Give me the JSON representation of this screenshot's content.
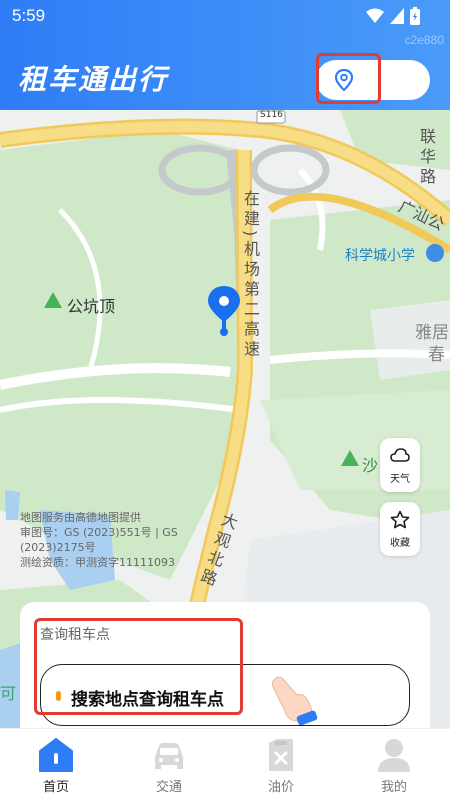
{
  "status_bar": {
    "time": "5:59"
  },
  "device_id": "c2e880",
  "header": {
    "title": "租车通出行"
  },
  "map": {
    "roads": {
      "top_route": "S116",
      "airport_road": "在建)机场第二高速",
      "daguan_road": "大观北路",
      "guangshan": "广汕公",
      "lianhua": "联华路"
    },
    "places": {
      "gongkengding": "公坑顶",
      "school": "科学城小学",
      "yaju": "雅居",
      "chun": "春",
      "sha": "沙"
    },
    "attribution": [
      "地图服务由高德地图提供",
      "审图号：GS (2023)551号 | GS",
      "(2023)2175号",
      "测绘资质：甲测资字11111093"
    ],
    "tools": {
      "weather": "天气",
      "favorite": "收藏"
    }
  },
  "sheet": {
    "title": "查询租车点",
    "search_label": "搜索地点查询租车点"
  },
  "partial_left_text": "可",
  "tabs": [
    {
      "label": "首页",
      "icon": "home-icon",
      "active": true
    },
    {
      "label": "交通",
      "icon": "car-icon",
      "active": false
    },
    {
      "label": "油价",
      "icon": "fuel-icon",
      "active": false
    },
    {
      "label": "我的",
      "icon": "user-icon",
      "active": false
    }
  ],
  "colors": {
    "primary": "#2f7df6",
    "highlight": "#e23b32",
    "accent_dot": "#f39a1b"
  }
}
